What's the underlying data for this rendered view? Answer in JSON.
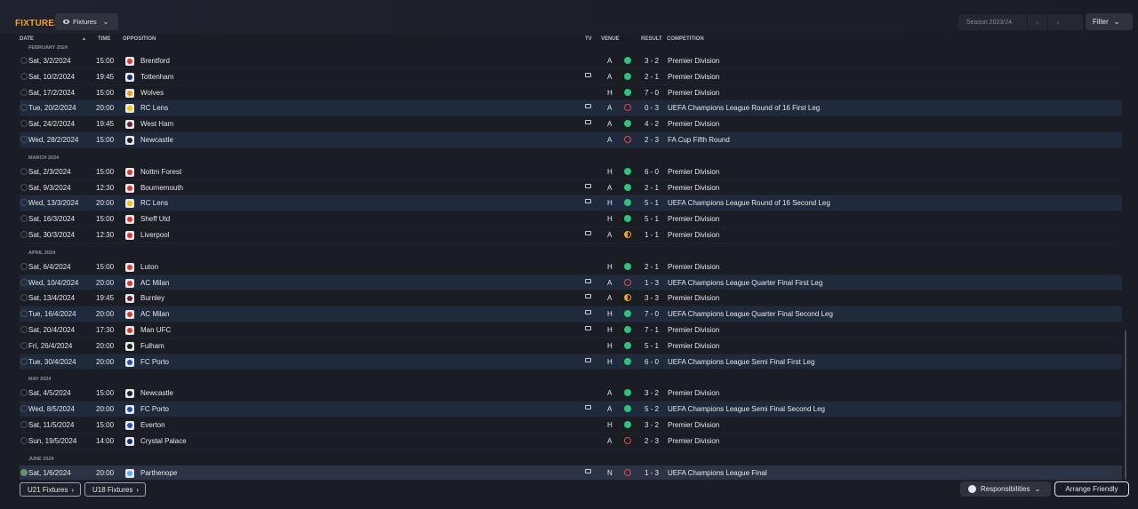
{
  "header": {
    "title": "FIXTURES",
    "view_button": "Fixtures",
    "season": "Season 2023/24",
    "filter": "Filter"
  },
  "columns": {
    "date": "DATE",
    "time": "TIME",
    "opposition": "OPPOSITION",
    "tv": "TV",
    "venue": "VENUE",
    "result": "RESULT",
    "competition": "COMPETITION"
  },
  "months": [
    {
      "label": "FEBRUARY 2024",
      "fixtures": [
        {
          "date": "Sat, 3/2/2024",
          "time": "15:00",
          "opp": "Brentford",
          "crest": "red",
          "tv": false,
          "venue": "A",
          "outcome": "win",
          "score": "3 - 2",
          "comp": "Premier Division",
          "hl": false
        },
        {
          "date": "Sat, 10/2/2024",
          "time": "19:45",
          "opp": "Tottenham",
          "crest": "navy",
          "tv": true,
          "venue": "A",
          "outcome": "win",
          "score": "2 - 1",
          "comp": "Premier Division",
          "hl": false
        },
        {
          "date": "Sat, 17/2/2024",
          "time": "15:00",
          "opp": "Wolves",
          "crest": "gold",
          "tv": false,
          "venue": "H",
          "outcome": "win",
          "score": "7 - 0",
          "comp": "Premier Division",
          "hl": false
        },
        {
          "date": "Tue, 20/2/2024",
          "time": "20:00",
          "opp": "RC Lens",
          "crest": "yellow",
          "tv": true,
          "venue": "A",
          "outcome": "loss",
          "score": "0 - 3",
          "comp": "UEFA Champions League Round of 16 First Leg",
          "hl": true
        },
        {
          "date": "Sat, 24/2/2024",
          "time": "19:45",
          "opp": "West Ham",
          "crest": "maroon",
          "tv": true,
          "venue": "A",
          "outcome": "win",
          "score": "4 - 2",
          "comp": "Premier Division",
          "hl": false
        },
        {
          "date": "Wed, 28/2/2024",
          "time": "15:00",
          "opp": "Newcastle",
          "crest": "black",
          "tv": false,
          "venue": "A",
          "outcome": "loss",
          "score": "2 - 3",
          "comp": "FA Cup Fifth Round",
          "hl": true
        }
      ]
    },
    {
      "label": "MARCH 2024",
      "fixtures": [
        {
          "date": "Sat, 2/3/2024",
          "time": "15:00",
          "opp": "Nottm Forest",
          "crest": "red",
          "tv": false,
          "venue": "H",
          "outcome": "win",
          "score": "6 - 0",
          "comp": "Premier Division",
          "hl": false
        },
        {
          "date": "Sat, 9/3/2024",
          "time": "12:30",
          "opp": "Bournemouth",
          "crest": "red",
          "tv": true,
          "venue": "A",
          "outcome": "win",
          "score": "2 - 1",
          "comp": "Premier Division",
          "hl": false
        },
        {
          "date": "Wed, 13/3/2024",
          "time": "20:00",
          "opp": "RC Lens",
          "crest": "yellow",
          "tv": true,
          "venue": "H",
          "outcome": "win",
          "score": "5 - 1",
          "comp": "UEFA Champions League Round of 16  Second Leg",
          "hl": true
        },
        {
          "date": "Sat, 16/3/2024",
          "time": "15:00",
          "opp": "Sheff Utd",
          "crest": "red",
          "tv": false,
          "venue": "H",
          "outcome": "win",
          "score": "5 - 1",
          "comp": "Premier Division",
          "hl": false
        },
        {
          "date": "Sat, 30/3/2024",
          "time": "12:30",
          "opp": "Liverpool",
          "crest": "red",
          "tv": true,
          "venue": "A",
          "outcome": "draw",
          "score": "1 - 1",
          "comp": "Premier Division",
          "hl": false
        }
      ]
    },
    {
      "label": "APRIL 2024",
      "fixtures": [
        {
          "date": "Sat, 6/4/2024",
          "time": "15:00",
          "opp": "Luton",
          "crest": "red",
          "tv": false,
          "venue": "H",
          "outcome": "win",
          "score": "2 - 1",
          "comp": "Premier Division",
          "hl": false
        },
        {
          "date": "Wed, 10/4/2024",
          "time": "20:00",
          "opp": "AC Milan",
          "crest": "red",
          "tv": true,
          "venue": "A",
          "outcome": "loss",
          "score": "1 - 3",
          "comp": "UEFA Champions League Quarter Final First Leg",
          "hl": true
        },
        {
          "date": "Sat, 13/4/2024",
          "time": "19:45",
          "opp": "Burnley",
          "crest": "maroon",
          "tv": true,
          "venue": "A",
          "outcome": "draw",
          "score": "3 - 3",
          "comp": "Premier Division",
          "hl": false
        },
        {
          "date": "Tue, 16/4/2024",
          "time": "20:00",
          "opp": "AC Milan",
          "crest": "red",
          "tv": true,
          "venue": "H",
          "outcome": "win",
          "score": "7 - 0",
          "comp": "UEFA Champions League Quarter Final Second Leg",
          "hl": true
        },
        {
          "date": "Sat, 20/4/2024",
          "time": "17:30",
          "opp": "Man UFC",
          "crest": "red",
          "tv": true,
          "venue": "H",
          "outcome": "win",
          "score": "7 - 1",
          "comp": "Premier Division",
          "hl": false
        },
        {
          "date": "Fri, 26/4/2024",
          "time": "20:00",
          "opp": "Fulham",
          "crest": "black",
          "tv": false,
          "venue": "H",
          "outcome": "win",
          "score": "5 - 1",
          "comp": "Premier Division",
          "hl": false
        },
        {
          "date": "Tue, 30/4/2024",
          "time": "20:00",
          "opp": "FC Porto",
          "crest": "blue",
          "tv": true,
          "venue": "H",
          "outcome": "win",
          "score": "6 - 0",
          "comp": "UEFA Champions League Semi Final First Leg",
          "hl": true
        }
      ]
    },
    {
      "label": "MAY 2024",
      "fixtures": [
        {
          "date": "Sat, 4/5/2024",
          "time": "15:00",
          "opp": "Newcastle",
          "crest": "black",
          "tv": false,
          "venue": "A",
          "outcome": "win",
          "score": "3 - 2",
          "comp": "Premier Division",
          "hl": false
        },
        {
          "date": "Wed, 8/5/2024",
          "time": "20:00",
          "opp": "FC Porto",
          "crest": "blue",
          "tv": true,
          "venue": "A",
          "outcome": "win",
          "score": "5 - 2",
          "comp": "UEFA Champions League Semi Final Second Leg",
          "hl": true
        },
        {
          "date": "Sat, 11/5/2024",
          "time": "15:00",
          "opp": "Everton",
          "crest": "blue",
          "tv": false,
          "venue": "H",
          "outcome": "win",
          "score": "3 - 2",
          "comp": "Premier Division",
          "hl": false
        },
        {
          "date": "Sun, 19/5/2024",
          "time": "14:00",
          "opp": "Crystal Palace",
          "crest": "navy",
          "tv": false,
          "venue": "A",
          "outcome": "loss",
          "score": "2 - 3",
          "comp": "Premier Division",
          "hl": false
        }
      ]
    },
    {
      "label": "JUNE 2024",
      "fixtures": [
        {
          "date": "Sat, 1/6/2024",
          "time": "20:00",
          "opp": "Parthenope",
          "crest": "sky",
          "tv": true,
          "venue": "N",
          "outcome": "loss",
          "score": "1 - 3",
          "comp": "UEFA Champions League Final",
          "hl": true,
          "last": true
        }
      ]
    }
  ],
  "footer": {
    "u21": "U21 Fixtures",
    "u18": "U18 Fixtures",
    "responsibilities": "Responsibilities",
    "arrange": "Arrange Friendly"
  }
}
